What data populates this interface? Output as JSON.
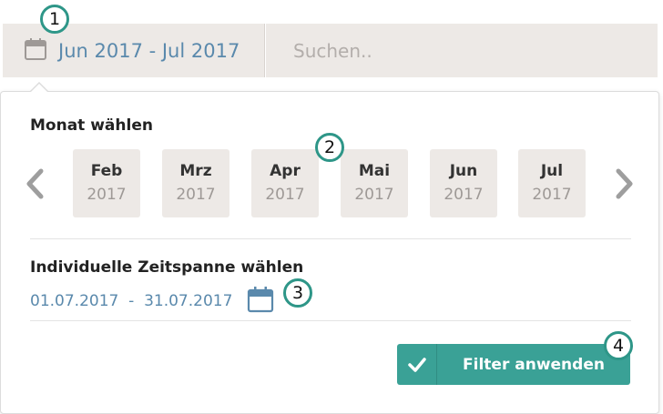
{
  "filter_bar": {
    "date_range_label": "Jun 2017 - Jul 2017",
    "search_placeholder": "Suchen..",
    "search_value": ""
  },
  "month_picker": {
    "title": "Monat wählen",
    "months": [
      {
        "name": "Feb",
        "year": "2017"
      },
      {
        "name": "Mrz",
        "year": "2017"
      },
      {
        "name": "Apr",
        "year": "2017"
      },
      {
        "name": "Mai",
        "year": "2017"
      },
      {
        "name": "Jun",
        "year": "2017"
      },
      {
        "name": "Jul",
        "year": "2017"
      }
    ]
  },
  "custom_range": {
    "title": "Individuelle Zeitspanne wählen",
    "range_label": "01.07.2017  -  31.07.2017"
  },
  "apply_button": {
    "label": "Filter anwenden"
  },
  "callouts": [
    "1",
    "2",
    "3",
    "4"
  ],
  "colors": {
    "accent_blue": "#5a89ac",
    "button_teal": "#3aa196",
    "tile_background": "#ede9e6",
    "callout_ring": "#2e9688"
  },
  "icons": {
    "date_range": "calendar-icon",
    "custom_range": "calendar-icon",
    "previous": "chevron-left-icon",
    "next": "chevron-right-icon",
    "apply": "check-icon"
  }
}
